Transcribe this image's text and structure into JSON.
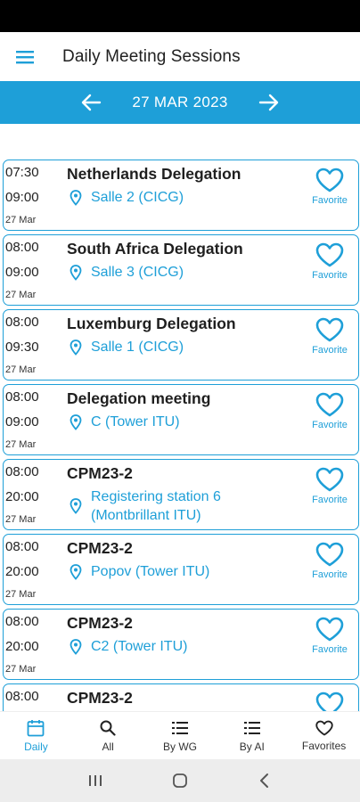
{
  "header": {
    "title": "Daily Meeting Sessions",
    "menu_icon": "hamburger-menu-icon"
  },
  "date_nav": {
    "date": "27 MAR 2023",
    "prev_icon": "arrow-left-icon",
    "next_icon": "arrow-right-icon"
  },
  "colors": {
    "accent": "#1e9fd8",
    "text": "#1f1f1f"
  },
  "sessions": [
    {
      "start": "07:30",
      "end": "09:00",
      "day": "27 Mar",
      "title": "Netherlands Delegation",
      "location": "Salle 2 (CICG)",
      "favorite_label": "Favorite"
    },
    {
      "start": "08:00",
      "end": "09:00",
      "day": "27 Mar",
      "title": "South Africa Delegation",
      "location": "Salle 3 (CICG)",
      "favorite_label": "Favorite"
    },
    {
      "start": "08:00",
      "end": "09:30",
      "day": "27 Mar",
      "title": "Luxemburg Delegation",
      "location": "Salle 1 (CICG)",
      "favorite_label": "Favorite"
    },
    {
      "start": "08:00",
      "end": "09:00",
      "day": "27 Mar",
      "title": "Delegation meeting",
      "location": "C (Tower ITU)",
      "favorite_label": "Favorite"
    },
    {
      "start": "08:00",
      "end": "20:00",
      "day": "27 Mar",
      "title": "CPM23-2",
      "location_line1": "Registering station 6",
      "location_line2": "(Montbrillant ITU)",
      "favorite_label": "Favorite"
    },
    {
      "start": "08:00",
      "end": "20:00",
      "day": "27 Mar",
      "title": "CPM23-2",
      "location": "Popov (Tower ITU)",
      "favorite_label": "Favorite"
    },
    {
      "start": "08:00",
      "end": "20:00",
      "day": "27 Mar",
      "title": "CPM23-2",
      "location": "C2 (Tower ITU)",
      "favorite_label": "Favorite"
    },
    {
      "start": "08:00",
      "title": "CPM23-2"
    }
  ],
  "bottom_nav": [
    {
      "label": "Daily",
      "icon": "calendar-icon",
      "active": true
    },
    {
      "label": "All",
      "icon": "search-icon"
    },
    {
      "label": "By WG",
      "icon": "list-icon"
    },
    {
      "label": "By AI",
      "icon": "list-icon"
    },
    {
      "label": "Favorites",
      "icon": "heart-icon"
    }
  ]
}
